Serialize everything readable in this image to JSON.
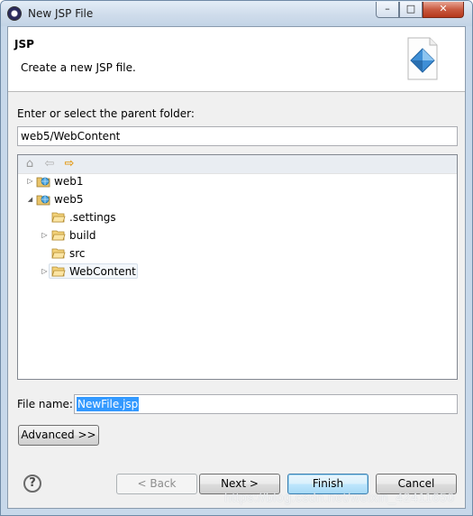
{
  "window": {
    "title": "New JSP File",
    "controls": {
      "minimize": "–",
      "maximize": "□",
      "close": "✕"
    }
  },
  "header": {
    "title": "JSP",
    "description": "Create a new JSP file."
  },
  "parent_folder": {
    "label": "Enter or select the parent folder:",
    "value": "web5/WebContent"
  },
  "tree_toolbar": {
    "icons": [
      "home-icon",
      "back-arrow-icon",
      "forward-arrow-icon"
    ],
    "home": "⌂",
    "back": "⇦",
    "forward": "⇨"
  },
  "tree": {
    "expand_glyph": "▷",
    "collapse_glyph": "◢",
    "nodes": [
      {
        "label": "web1",
        "type": "project",
        "state": "collapsed"
      },
      {
        "label": "web5",
        "type": "project",
        "state": "expanded"
      },
      {
        "label": ".settings",
        "type": "folder",
        "state": "leaf"
      },
      {
        "label": "build",
        "type": "folder",
        "state": "collapsed"
      },
      {
        "label": "src",
        "type": "folder",
        "state": "leaf"
      },
      {
        "label": "WebContent",
        "type": "folder",
        "state": "collapsed",
        "selected": true
      }
    ]
  },
  "file_name": {
    "label": "File name:",
    "value": "NewFile.jsp"
  },
  "buttons": {
    "advanced": "Advanced >>",
    "help": "?",
    "back": "< Back",
    "next": "Next >",
    "finish": "Finish",
    "cancel": "Cancel"
  },
  "watermark": "https://blog.csdn.net/weixin_42411650",
  "colors": {
    "title_bar": "#cfdceb",
    "dialog_bg": "#f0f0f0",
    "selection": "#3399ff",
    "close_button": "#c95a40",
    "default_button_border": "#3c7fb1"
  }
}
